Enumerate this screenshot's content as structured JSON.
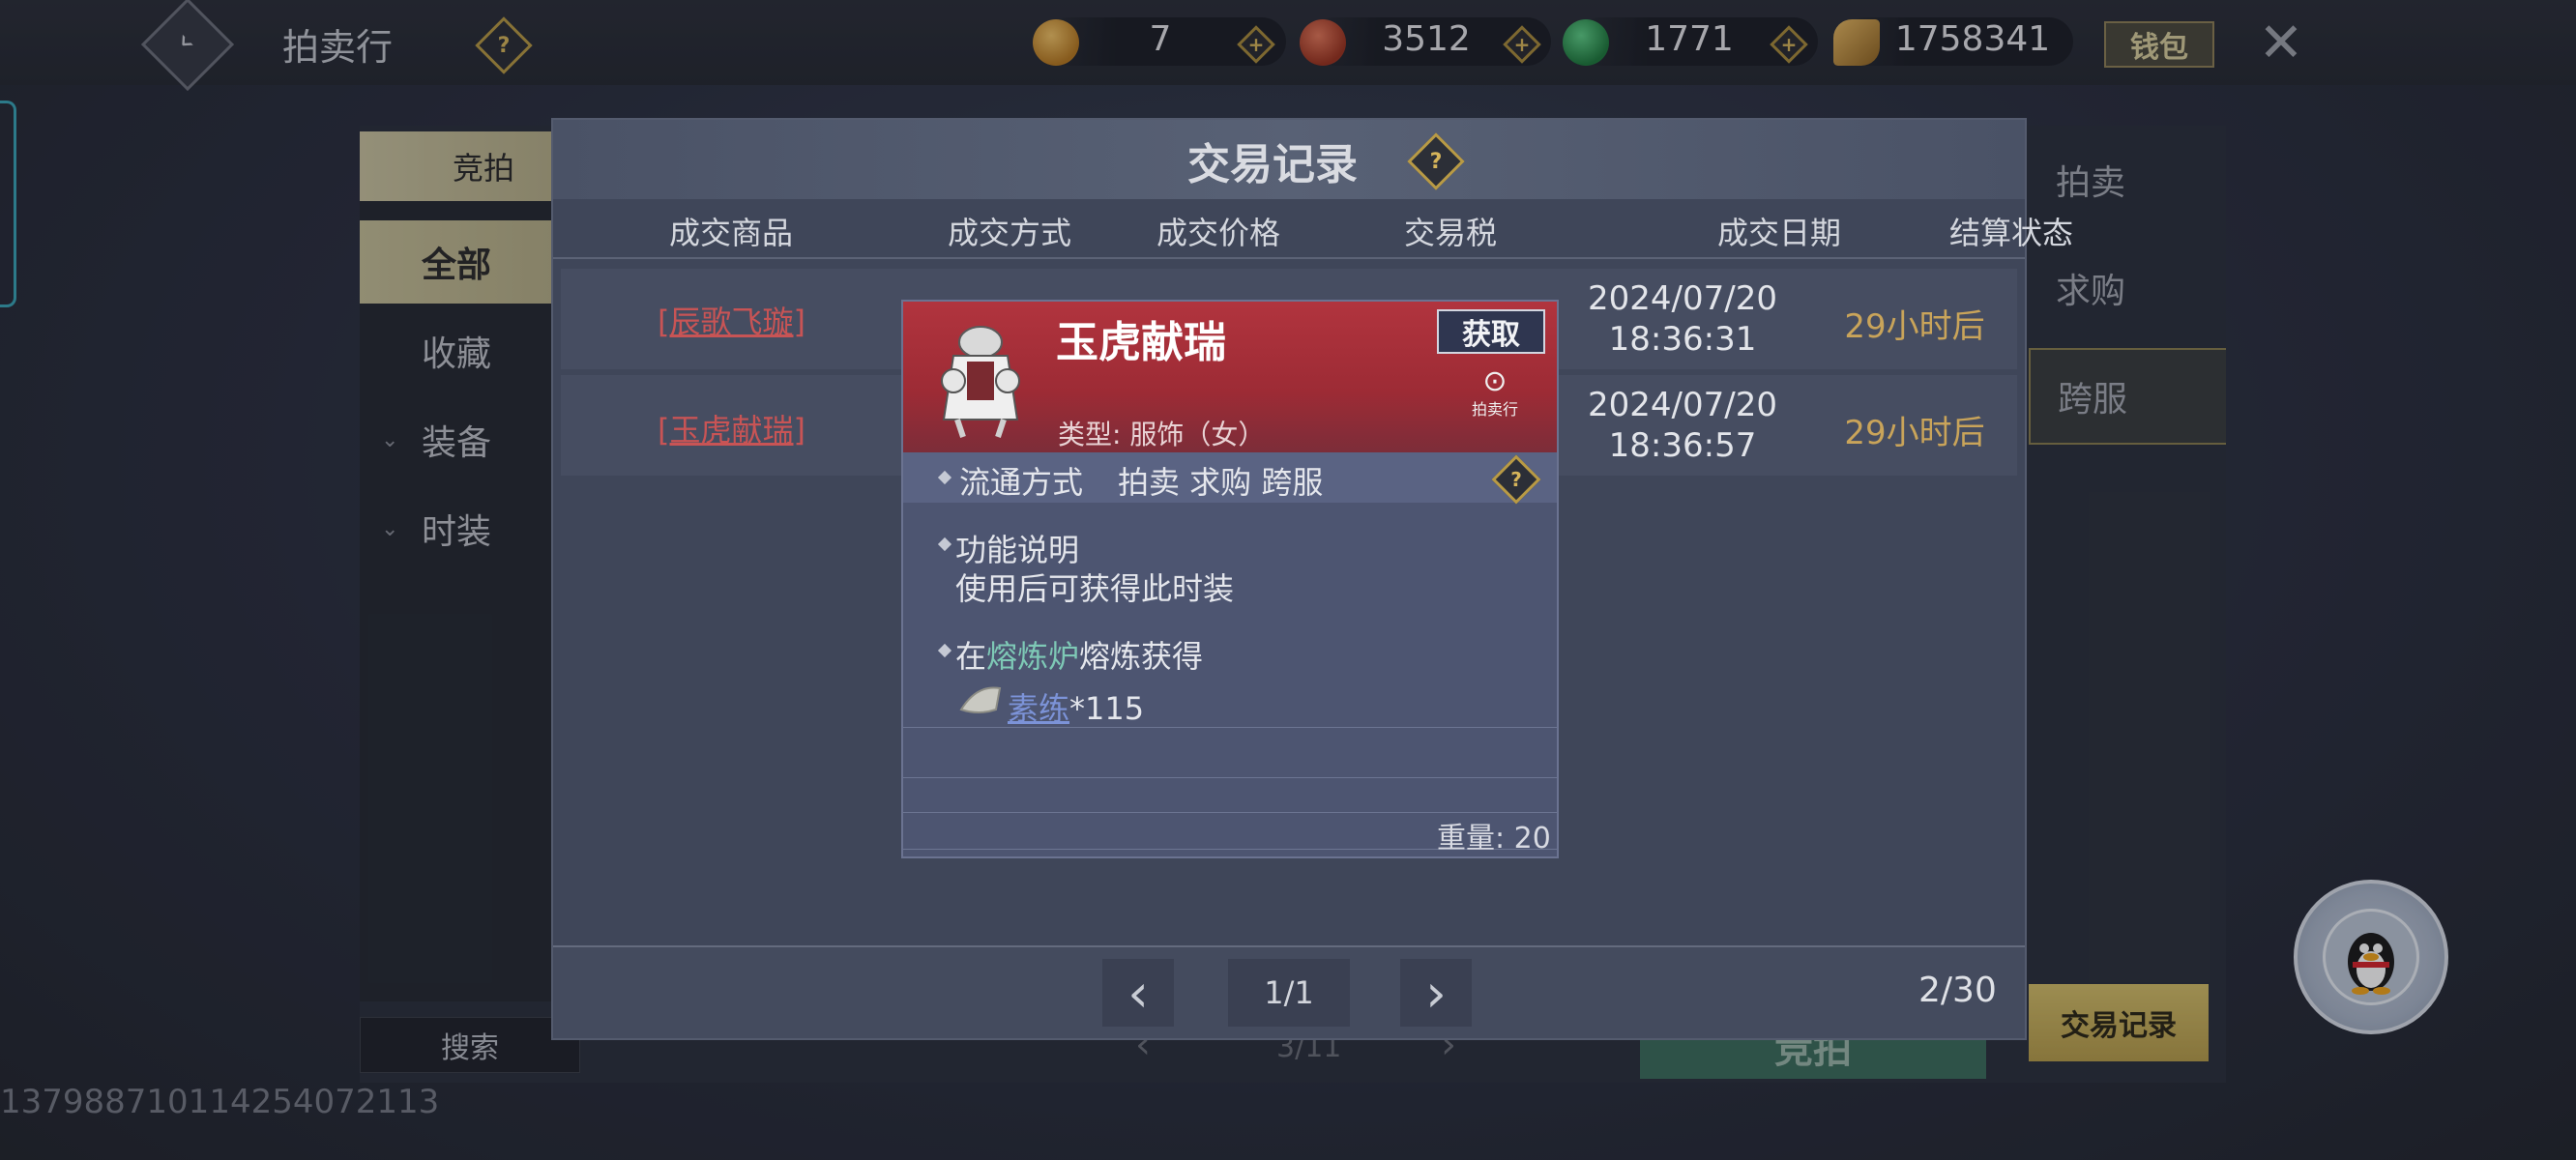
{
  "header": {
    "title": "拍卖行",
    "currencies": [
      {
        "icon": "gold-ingot-coin-icon",
        "value": "7",
        "color": "#c98a2e"
      },
      {
        "icon": "red-swirl-coin-icon",
        "value": "3512",
        "color": "#b24a2f"
      },
      {
        "icon": "jade-coin-icon",
        "value": "1771",
        "color": "#2f8f4e"
      },
      {
        "icon": "gold-leaf-coin-icon",
        "value": "1758341",
        "color": "#b58a3a"
      }
    ],
    "wallet_label": "钱包"
  },
  "sidebar": {
    "mode_tab": "竞拍",
    "categories": [
      "全部",
      "收藏",
      "装备",
      "时装"
    ],
    "search_label": "搜索"
  },
  "right_tabs": [
    "拍卖",
    "求购",
    "跨服"
  ],
  "trade_record_button": "交易记录",
  "bid_button": "竞拍",
  "background_pager": "3/11",
  "user_id": "1379887101142540721​13",
  "modal": {
    "title": "交易记录",
    "columns": [
      "成交商品",
      "成交方式",
      "成交价格",
      "交易税",
      "成交日期",
      "结算状态"
    ],
    "rows": [
      {
        "item": "[辰歌飞璇]",
        "date": "2024/07/20",
        "time": "18:36:31",
        "status": "29小时后"
      },
      {
        "item": "[玉虎献瑞]",
        "date": "2024/07/20",
        "time": "18:36:57",
        "status": "29小时后"
      }
    ],
    "pager": "1/1",
    "count": "2/30"
  },
  "tooltip": {
    "name": "玉虎献瑞",
    "obtain_label": "获取",
    "source_icon_label": "拍卖行",
    "type": "类型: 服饰（女）",
    "circulation_label": "流通方式",
    "circulation_values": "拍卖 求购 跨服",
    "function_label": "功能说明",
    "function_desc": "使用后可获得此时装",
    "smelt_prefix": "在",
    "smelt_place": "熔炼炉",
    "smelt_suffix": "熔炼获得",
    "material_name": "素练",
    "material_qty": "*115",
    "weight": "重量: 20"
  }
}
